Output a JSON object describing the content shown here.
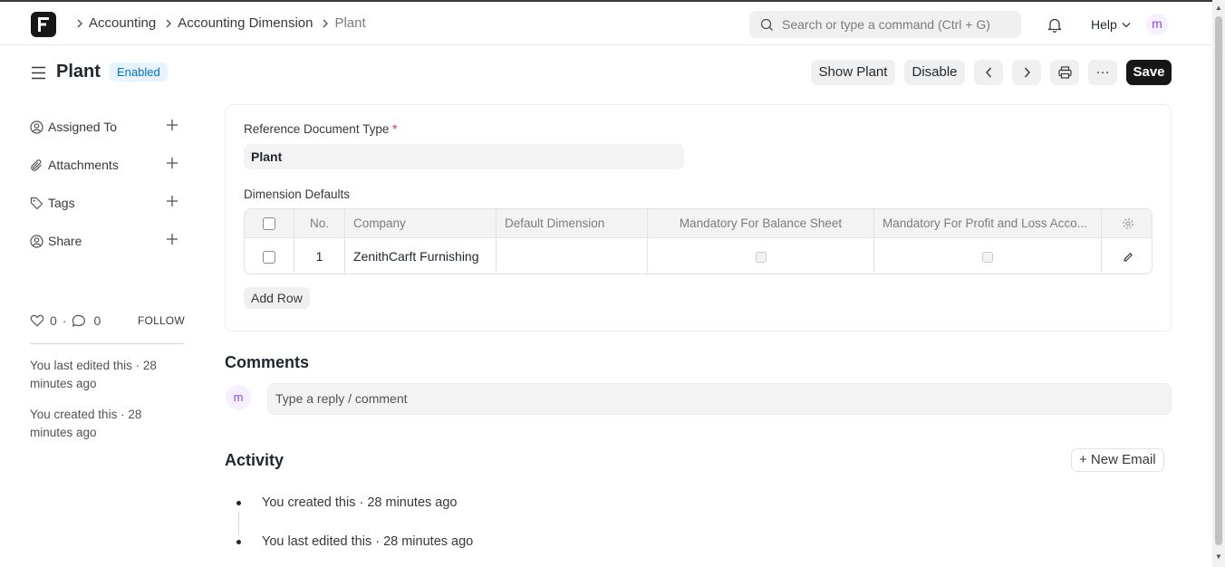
{
  "navbar": {
    "breadcrumbs": [
      "Accounting",
      "Accounting Dimension",
      "Plant"
    ],
    "search_placeholder": "Search or type a command (Ctrl + G)",
    "help_label": "Help",
    "avatar_initial": "m"
  },
  "header": {
    "title": "Plant",
    "status": "Enabled",
    "show_button": "Show Plant",
    "disable_button": "Disable",
    "more_label": "···",
    "save_button": "Save"
  },
  "sidebar": {
    "items": [
      {
        "label": "Assigned To",
        "icon": "user-assign-icon"
      },
      {
        "label": "Attachments",
        "icon": "paperclip-icon"
      },
      {
        "label": "Tags",
        "icon": "tag-icon"
      },
      {
        "label": "Share",
        "icon": "share-user-icon"
      }
    ],
    "likes": "0",
    "comments": "0",
    "dot": "·",
    "follow_label": "FOLLOW",
    "notes": [
      "You last edited this · 28 minutes ago",
      "You created this · 28 minutes ago"
    ]
  },
  "form": {
    "ref_label": "Reference Document Type",
    "required_mark": "*",
    "ref_value": "Plant",
    "defaults_label": "Dimension Defaults",
    "columns": [
      "No.",
      "Company",
      "Default Dimension",
      "Mandatory For Balance Sheet",
      "Mandatory For Profit and Loss Acco..."
    ],
    "rows": [
      {
        "no": "1",
        "company": "ZenithCarft Furnishing",
        "default_dimension": "",
        "mandatory_bs": false,
        "mandatory_pl": false
      }
    ],
    "add_row_label": "Add Row"
  },
  "comments": {
    "title": "Comments",
    "avatar_initial": "m",
    "placeholder": "Type a reply / comment"
  },
  "activity": {
    "title": "Activity",
    "new_email_label": "+ New Email",
    "items": [
      "You created this · 28 minutes ago",
      "You last edited this · 28 minutes ago"
    ]
  }
}
